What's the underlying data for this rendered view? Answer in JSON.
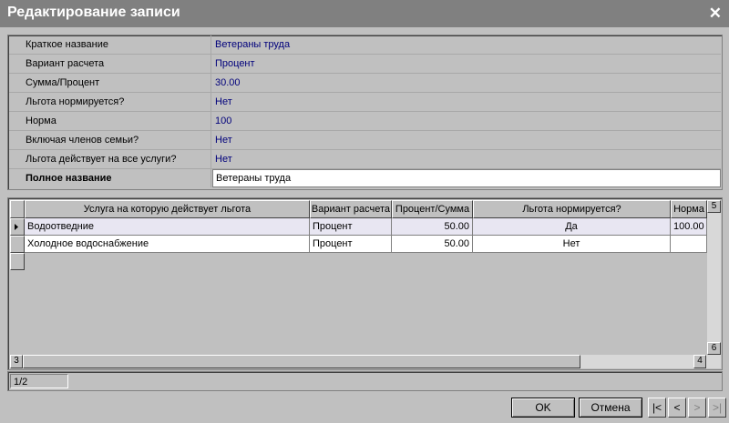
{
  "window": {
    "title": "Редактирование записи"
  },
  "properties": [
    {
      "label": "Краткое название",
      "value": "Ветераны труда"
    },
    {
      "label": "Вариант расчета",
      "value": "Процент"
    },
    {
      "label": "Сумма/Процент",
      "value": "30.00"
    },
    {
      "label": "Льгота нормируется?",
      "value": "Нет"
    },
    {
      "label": "Норма",
      "value": "100"
    },
    {
      "label": "Включая членов семьи?",
      "value": "Нет"
    },
    {
      "label": "Льгота действует на все услуги?",
      "value": "Нет"
    },
    {
      "label": "Полное название",
      "value": "Ветераны труда"
    }
  ],
  "grid": {
    "columns": [
      "Услуга на которую действует льгота",
      "Вариант расчета",
      "Процент/Сумма",
      "Льгота нормируется?",
      "Норма"
    ],
    "rows": [
      [
        "Водоотведние",
        "Процент",
        "50.00",
        "Да",
        "100.00"
      ],
      [
        "Холодное водоснабжение",
        "Процент",
        "50.00",
        "Нет",
        ""
      ]
    ],
    "scroll_up": "5",
    "scroll_down": "6",
    "scroll_left": "3",
    "scroll_right": "4"
  },
  "status": {
    "record": "1/2"
  },
  "buttons": {
    "ok": "OK",
    "cancel": "Отмена"
  },
  "nav": {
    "first": "|<",
    "prev": "<",
    "next": ">",
    "last": ">|"
  }
}
